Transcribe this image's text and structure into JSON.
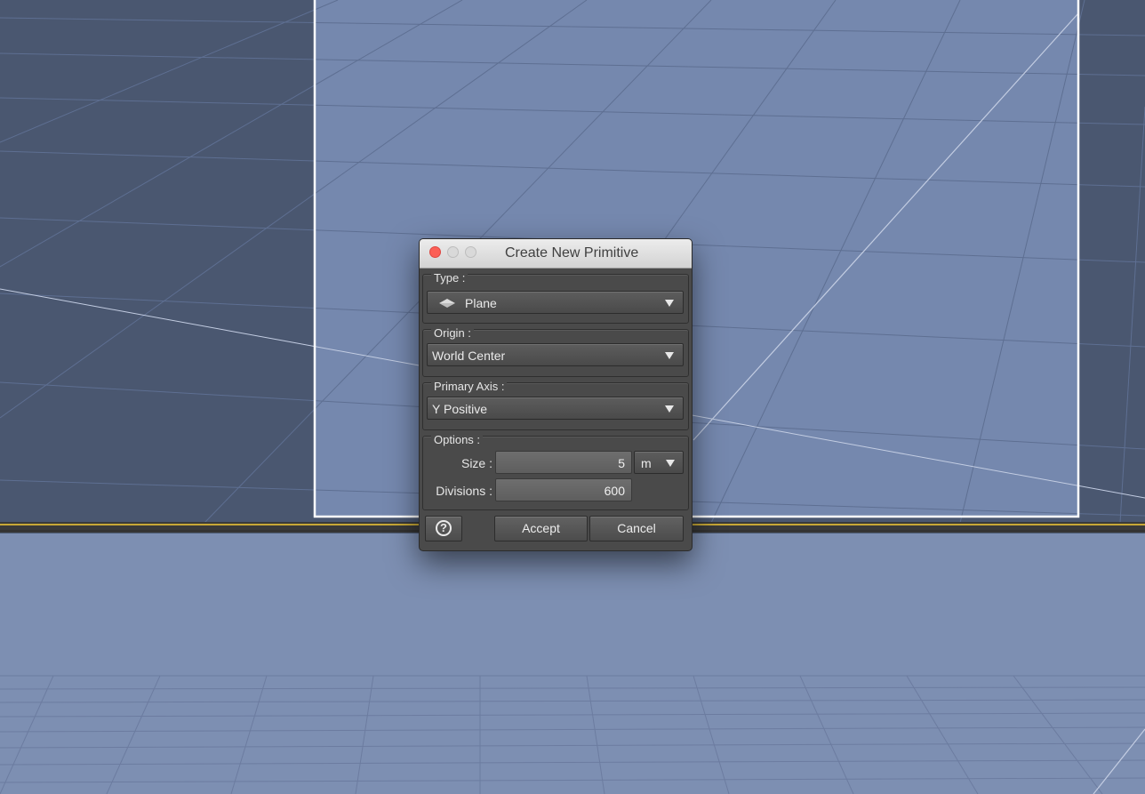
{
  "dialog": {
    "title": "Create New Primitive"
  },
  "type_group": {
    "label": "Type :",
    "value": "Plane",
    "icon": "plane-icon"
  },
  "origin_group": {
    "label": "Origin :",
    "value": "World Center"
  },
  "axis_group": {
    "label": "Primary Axis :",
    "value": "Y Positive"
  },
  "options_group": {
    "label": "Options :",
    "size_label": "Size :",
    "size_value": "5",
    "unit_value": "m",
    "divisions_label": "Divisions :",
    "divisions_value": "600"
  },
  "footer": {
    "help_glyph": "?",
    "accept_label": "Accept",
    "cancel_label": "Cancel"
  },
  "colors": {
    "viewport_blue": "#7d8fb2",
    "panel_gray": "#4a4a4a",
    "accent_yellow": "#c8a836",
    "close_red": "#fb5f56"
  }
}
